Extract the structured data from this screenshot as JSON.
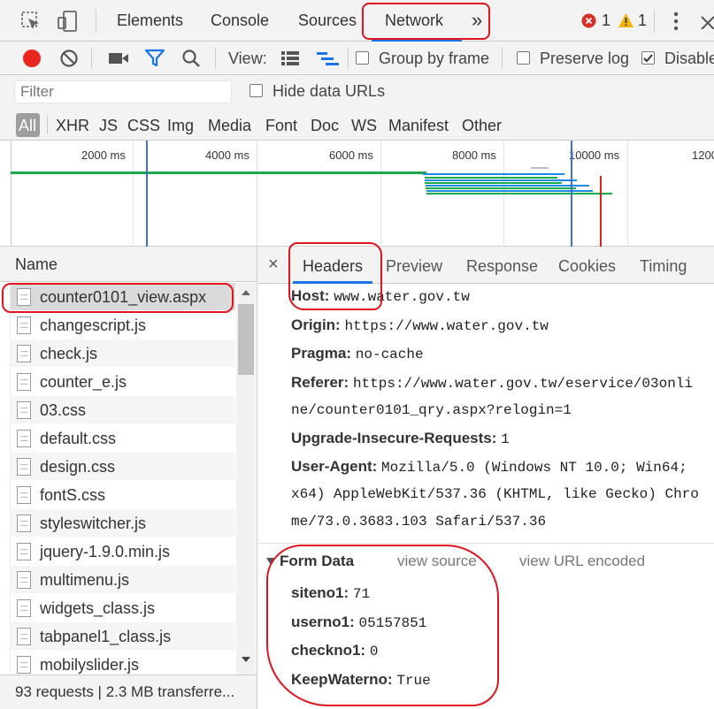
{
  "tabs": {
    "items": [
      "Elements",
      "Console",
      "Sources",
      "Network"
    ],
    "active": "Network",
    "more": "»",
    "errors": "1",
    "warnings": "1"
  },
  "toolbar": {
    "view_label": "View:",
    "group_by_frame": "Group by frame",
    "preserve_log": "Preserve log",
    "disable_cache": "Disable"
  },
  "filter": {
    "placeholder": "Filter",
    "hide_data_urls": "Hide data URLs"
  },
  "types": [
    "All",
    "XHR",
    "JS",
    "CSS",
    "Img",
    "Media",
    "Font",
    "Doc",
    "WS",
    "Manifest",
    "Other"
  ],
  "timeline": {
    "ticks": [
      "2000 ms",
      "4000 ms",
      "6000 ms",
      "8000 ms",
      "10000 ms",
      "1200"
    ]
  },
  "requests": {
    "column": "Name",
    "files": [
      "counter0101_view.aspx",
      "changescript.js",
      "check.js",
      "counter_e.js",
      "03.css",
      "default.css",
      "design.css",
      "fontS.css",
      "styleswitcher.js",
      "jquery-1.9.0.min.js",
      "multimenu.js",
      "widgets_class.js",
      "tabpanel1_class.js",
      "mobilyslider.js"
    ],
    "selected_index": 0
  },
  "status": {
    "text": "93 requests  |  2.3 MB transferre..."
  },
  "detail": {
    "tabs": [
      "Headers",
      "Preview",
      "Response",
      "Cookies",
      "Timing"
    ],
    "active_tab": "Headers",
    "close": "×",
    "headers": [
      {
        "key": "Host:",
        "value": "www.water.gov.tw"
      },
      {
        "key": "Origin:",
        "value": "https://www.water.gov.tw"
      },
      {
        "key": "Pragma:",
        "value": "no-cache"
      },
      {
        "key": "Referer:",
        "value": "https://www.water.gov.tw/eservice/03onli"
      },
      {
        "key": "",
        "value": "ne/counter0101_qry.aspx?relogin=1"
      },
      {
        "key": "Upgrade-Insecure-Requests:",
        "value": "1"
      },
      {
        "key": "User-Agent:",
        "value": "Mozilla/5.0 (Windows NT 10.0; Win64;"
      },
      {
        "key": "",
        "value": "x64) AppleWebKit/537.36 (KHTML, like Gecko) Chro"
      },
      {
        "key": "",
        "value": "me/73.0.3683.103 Safari/537.36"
      }
    ],
    "form_data": {
      "title": "Form Data",
      "view_source": "view source",
      "view_url_encoded": "view URL encoded",
      "fields": [
        {
          "key": "siteno1:",
          "value": "71"
        },
        {
          "key": "userno1:",
          "value": "05157851"
        },
        {
          "key": "checkno1:",
          "value": "0"
        },
        {
          "key": "KeepWaterno:",
          "value": "True"
        }
      ]
    }
  },
  "colors": {
    "record": "#e8261e",
    "filter_active": "#1a73e8",
    "annotation": "#e0141e",
    "error": "#d93025",
    "warning": "#f4b400"
  }
}
